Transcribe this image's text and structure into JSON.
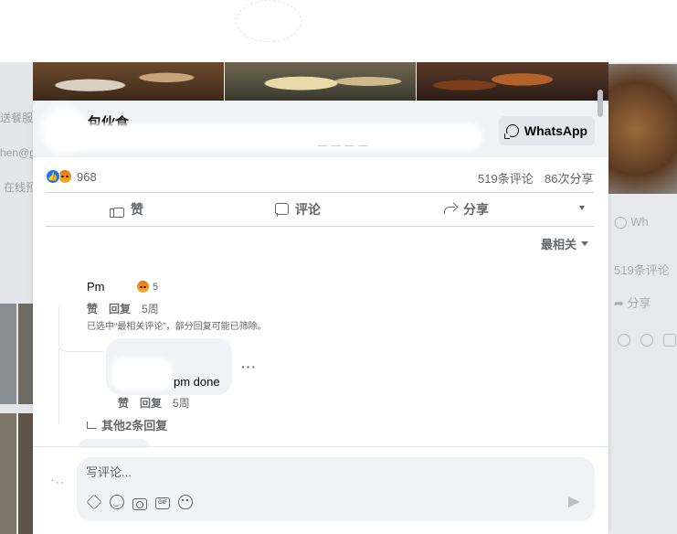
{
  "post": {
    "page_name": "包伙食",
    "whatsapp_label": "WhatsApp",
    "reaction_count": "968",
    "comment_count": "519条评论",
    "share_count": "86次分享"
  },
  "actions": {
    "like": "赞",
    "comment": "评论",
    "share": "分享"
  },
  "sort": {
    "label": "最相关"
  },
  "comments": [
    {
      "text": "Pm",
      "reaction_count": "5",
      "like_label": "赞",
      "reply_label": "回复",
      "time": "5周"
    }
  ],
  "notice": "已选中“最相关评论”，部分回复可能已筛除。",
  "reply": {
    "text": "pm done",
    "like_label": "赞",
    "reply_label": "回复",
    "time": "5周",
    "more": "···"
  },
  "more_replies": "其他2条回复",
  "composer": {
    "placeholder": "写评论...",
    "avatar_hint": "- , ,"
  },
  "background": {
    "left_texts": [
      "送餐服",
      "hen@g",
      "在线预"
    ],
    "right_whatsapp": "Wh",
    "right_comments": "519条评论",
    "right_share": "分享"
  },
  "colors": {
    "accent_blue": "#1877f2",
    "secondary_text": "#65676b",
    "bubble_gray": "#f0f2f5"
  }
}
